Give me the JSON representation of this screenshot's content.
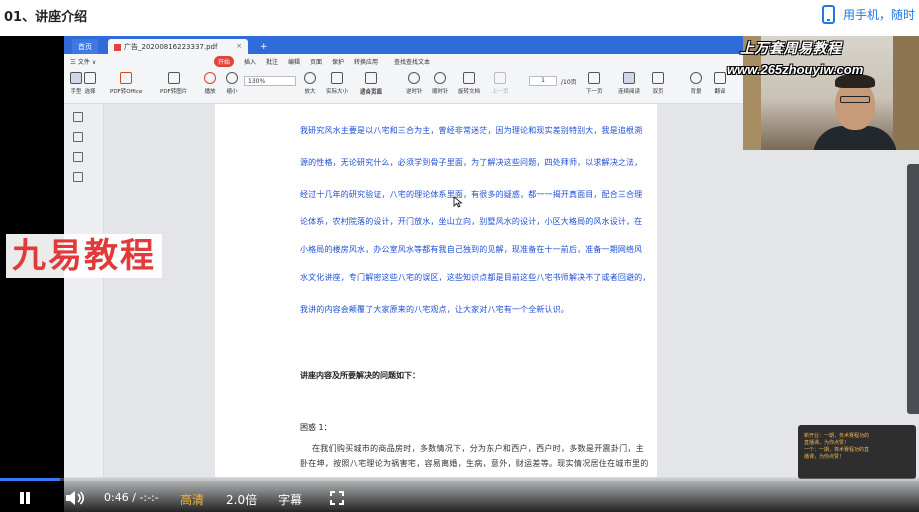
{
  "page": {
    "lesson_title": "01、讲座介绍",
    "mobile_link": "用手机，随时"
  },
  "wps": {
    "tabs": {
      "home": "首页",
      "document": "广告_20200816223337.pdf",
      "close": "×",
      "new": "+"
    },
    "menu": {
      "file": "三 文件 ∨",
      "items": [
        "开始",
        "插入",
        "批注",
        "编辑",
        "页面",
        "保护",
        "转换应用"
      ],
      "active": "开始",
      "search": "查找查找文本"
    },
    "ribbon": {
      "buttons": [
        "手型",
        "选择",
        "PDF转Office",
        "PDF转图片",
        "播放",
        "缩小",
        "放大",
        "实际大小",
        "适合宽度",
        "适合页面",
        "逆时针",
        "顺时针",
        "旋转文档",
        "上一页",
        "下一页",
        "连续阅读",
        "双页",
        "背景",
        "翻译"
      ],
      "zoom_value": "130%",
      "page_current": "1",
      "page_total": "/10页"
    }
  },
  "document": {
    "paragraph_lines": [
      "我研究风水主要是以八宅和三合为主，曾经非常迷茫，因为理论和现实差别特别大，我是追根溯",
      "源的性格，无论研究什么，必须学到骨子里面，为了解决这些问题，四处拜师，以求解决之法，",
      "经过十几年的研究验证，八宅的理论体系里面，有很多的疑惑，都一一揭开真面目，配合三合理",
      "论体系，农村院落的设计，开门放水，坐山立向，别墅风水的设计，小区大格局的风水设计，在",
      "小格局的楼房风水，办公室风水等都有我自己独到的见解，现准备在十一前后，准备一期网络风",
      "水文化讲座，专门解密这些八宅的误区，这些知识点都是目前这些八宅书师解决不了或者回避的，",
      "我讲的内容会颠覆了大家原来的八宅观点，让大家对八宅有一个全新认识。"
    ],
    "section_heading": "讲座内容及所要解决的问题如下：",
    "subheading": "困惑 1：",
    "serif_lines": [
      "在我们购买城市的商品房时，多数情况下，分为东户和西户，西户时，多数是开震卦门，主",
      "卧在坤，按照八宅理论为祸害宅，容易离婚，生病，意外，财运差等。现实情况居住在城市里的"
    ]
  },
  "watermarks": {
    "course": "上万套周易教程",
    "url": "www.265zhouyiw.com",
    "brand": "九易教程"
  },
  "notification": {
    "lines": [
      "新开业：一期，务术赛程功的",
      "直播课，为你点赞！",
      "一个：一期，将术赛程功的直",
      "播课，为你点赞！"
    ]
  },
  "player": {
    "time": "0:46 / -:-:-",
    "quality": "高清",
    "speed": "2.0倍",
    "subtitles": "字幕",
    "progress": 0.065
  },
  "colors": {
    "accent": "#1e78e6",
    "doc_text": "#1f4fd6",
    "brand_red": "#e23a3a",
    "wps_blue": "#2f6bd9",
    "quality_gold": "#f7b731"
  }
}
